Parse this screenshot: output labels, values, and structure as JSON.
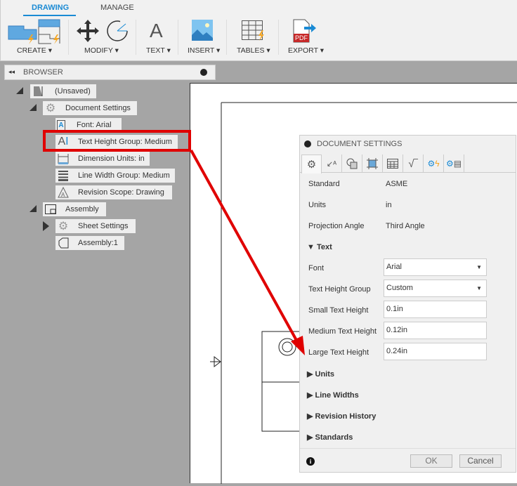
{
  "ribbon": {
    "tabs": [
      "DRAWING",
      "MANAGE"
    ],
    "groups": [
      "CREATE",
      "MODIFY",
      "TEXT",
      "INSERT",
      "TABLES",
      "EXPORT"
    ],
    "text_glyph": "A",
    "pdf_label": "PDF"
  },
  "browser": {
    "title": "BROWSER",
    "root": "(Unsaved)",
    "document_settings": "Document Settings",
    "items": [
      "Font: Arial",
      "Text Height Group: Medium",
      "Dimension Units: in",
      "Line Width Group: Medium",
      "Revision Scope: Drawing"
    ],
    "assembly": "Assembly",
    "sheet_settings": "Sheet Settings",
    "assembly_component": "Assembly:1"
  },
  "dialog": {
    "title": "DOCUMENT SETTINGS",
    "standard_label": "Standard",
    "standard": "ASME",
    "units_label": "Units",
    "units": "in",
    "projection_label": "Projection Angle",
    "projection": "Third Angle",
    "text_section": "Text",
    "font_label": "Font",
    "font": "Arial",
    "thg_label": "Text Height Group",
    "thg": "Custom",
    "small_label": "Small Text Height",
    "small": "0.1in",
    "medium_label": "Medium Text Height",
    "medium": "0.12in",
    "large_label": "Large Text Height",
    "large": "0.24in",
    "sections": [
      "Units",
      "Line Widths",
      "Revision History",
      "Standards"
    ],
    "ok": "OK",
    "cancel": "Cancel"
  },
  "colors": {
    "accent": "#1a8ad4",
    "annotation": "#e00000"
  }
}
